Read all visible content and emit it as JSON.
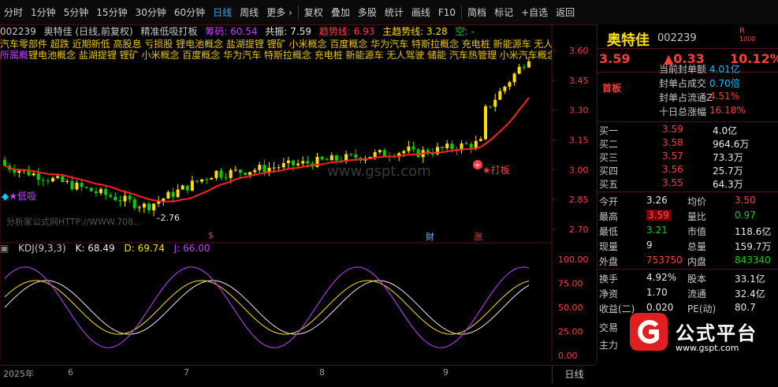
{
  "toolbar": {
    "items": [
      "分时",
      "1分钟",
      "5分钟",
      "15分钟",
      "30分钟",
      "60分钟",
      "日线",
      "周线",
      "更多 ›",
      "复权",
      "叠加",
      "多股",
      "统计",
      "画线",
      "F10",
      "简档",
      "标记",
      "+自选",
      "返回"
    ],
    "active_index": 6
  },
  "chart": {
    "stock_code": "002239",
    "stock_name": "奥特佳",
    "period_desc": "(日线,前复权)",
    "indicator": "精准低吸打板",
    "chip_label": "筹码: 60.54",
    "resonance": "共振: 7.59",
    "trend_line": "趋势线: 6.93",
    "main_line": "主趋势线: 3.28",
    "empty_label": "空: -",
    "concept_row1": "汽车零部件 超跌 近期新低 高股息 亏损股 锂电池概念 盐湖提锂 锂矿 小米概念 百度概念 华为汽车 特斯拉概念 充电桩 新能源车 无人驾驶 储能 汽车热管理 小米汽车",
    "concept_row2_prefix": "所属概",
    "concept_row2": "锂电池概念 盐湖提锂 锂矿 小米概念 百度概念 华为汽车 特斯拉概念 充电桩 新能源车 无人驾驶 储能 汽车热管理 小米汽车概念",
    "low_absorb_label": "★低吸",
    "daban_label": "★打板",
    "low_price_label": "2.76",
    "watermark_text": "分析家公式网HTTP://WWW.708...",
    "site_watermark": "www.gspt.com",
    "marker_s": "$",
    "marker_cai": "财",
    "marker_zhang": "涨",
    "kdj_title": "KDJ(9,3,3)",
    "kdj_k": "K: 68.49",
    "kdj_d": "D: 69.74",
    "kdj_j": "J: 66.00",
    "price_ticks": [
      "3.60",
      "3.45",
      "3.30",
      "3.15",
      "3.00",
      "2.85",
      "2.70"
    ],
    "kdj_ticks": [
      "100.00",
      "75.00",
      "50.00",
      "25.00",
      "0.00"
    ],
    "time_labels": [
      "2025年",
      "6",
      "7",
      "8",
      "9"
    ],
    "period_button": "日线"
  },
  "right_panel": {
    "name": "奥特佳",
    "code": "002239",
    "r_badge_top": "R",
    "r_badge_bottom": "1000",
    "price": "3.59",
    "change": "▲0.33",
    "change_pct": "10.12%",
    "board_label": "首板",
    "stats": [
      {
        "label": "当前封单额",
        "value": "4.01亿"
      },
      {
        "label": "封单占成交",
        "value": "0.70倍"
      },
      {
        "label": "封单占流通Z",
        "value": "4.51%"
      },
      {
        "label": "十日总涨幅",
        "value": "16.18%"
      }
    ],
    "bids": [
      {
        "label": "买一",
        "price": "3.59",
        "vol": "4.0亿"
      },
      {
        "label": "买二",
        "price": "3.58",
        "vol": "964.6万"
      },
      {
        "label": "买三",
        "price": "3.57",
        "vol": "73.3万"
      },
      {
        "label": "买四",
        "price": "3.56",
        "vol": "25.7万"
      },
      {
        "label": "买五",
        "price": "3.55",
        "vol": "64.3万"
      }
    ],
    "quote": [
      {
        "l1": "今开",
        "v1": "3.26",
        "l2": "均价",
        "v2": "3.50"
      },
      {
        "l1": "最高",
        "v1": "3.59",
        "l2": "量比",
        "v2": "0.97"
      },
      {
        "l1": "最低",
        "v1": "3.21",
        "l2": "市值",
        "v2": "118.6亿"
      },
      {
        "l1": "现量",
        "v1": "9",
        "l2": "总量",
        "v2": "159.7万"
      },
      {
        "l1": "外盘",
        "v1": "753750",
        "l2": "内盘",
        "v2": "843340"
      }
    ],
    "quote2": [
      {
        "l1": "换手",
        "v1": "4.92%",
        "l2": "股本",
        "v2": "33.1亿"
      },
      {
        "l1": "净资",
        "v1": "1.70",
        "l2": "流通",
        "v2": "32.4亿"
      },
      {
        "l1": "收益(二)",
        "v1": "0.020",
        "l2": "PE(动)",
        "v2": "80.7"
      }
    ],
    "extra_labels": [
      "交易",
      "主力"
    ],
    "watermark_cn": "公式平台",
    "watermark_url": "www.gspt.com"
  },
  "colors": {
    "up": "#ff3c3c",
    "down": "#00d000",
    "yellow": "#ffde00",
    "purple": "#c040ff",
    "cyan": "#00c8ff",
    "bg": "#000000"
  }
}
